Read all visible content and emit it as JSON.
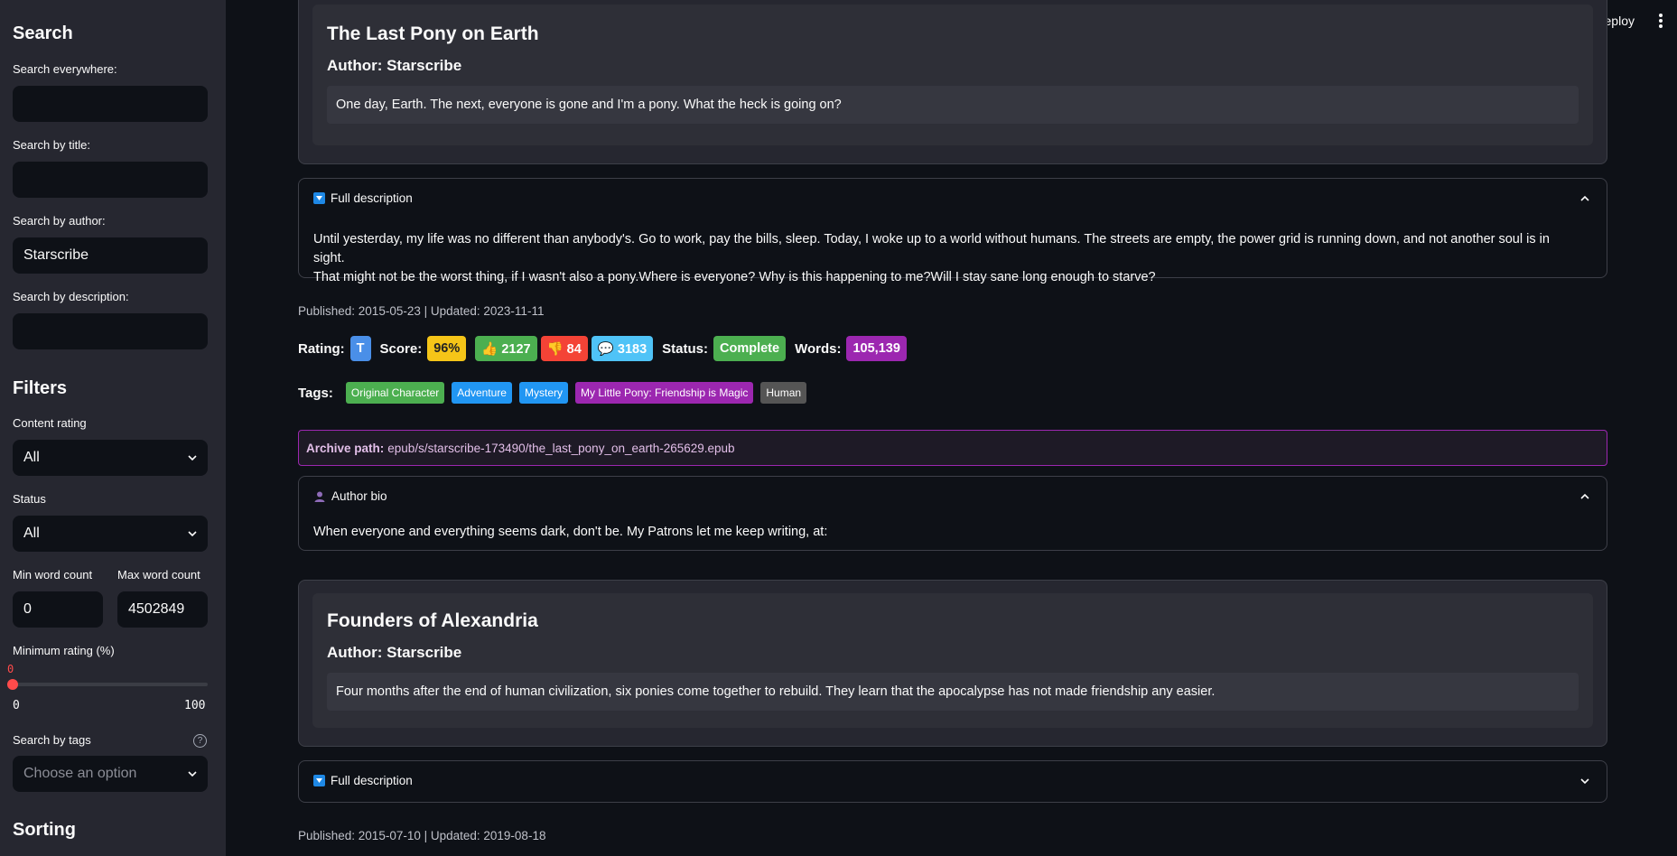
{
  "sidebar": {
    "search_title": "Search",
    "search_everywhere_label": "Search everywhere:",
    "search_everywhere_value": "",
    "search_title_label": "Search by title:",
    "search_title_value": "",
    "search_author_label": "Search by author:",
    "search_author_value": "Starscribe",
    "search_description_label": "Search by description:",
    "search_description_value": "",
    "filters_title": "Filters",
    "content_rating_label": "Content rating",
    "content_rating_value": "All",
    "status_label": "Status",
    "status_value": "All",
    "min_word_label": "Min word count",
    "min_word_value": "0",
    "max_word_label": "Max word count",
    "max_word_value": "4502849",
    "min_rating_label": "Minimum rating (%)",
    "min_rating_value": "0",
    "min_rating_min": "0",
    "min_rating_max": "100",
    "tags_label": "Search by tags",
    "tags_placeholder": "Choose an option",
    "help_glyph": "?",
    "sorting_title": "Sorting"
  },
  "header": {
    "deploy_label": "Deploy"
  },
  "stories": [
    {
      "title": "The Last Pony on Earth",
      "author": "Author: Starscribe",
      "short_description": "One day, Earth. The next, everyone is gone and I'm a pony. What the heck is going on?",
      "full_description_label": "Full description",
      "full_description_line1": "Until yesterday, my life was no different than anybody's. Go to work, pay the bills, sleep. Today, I woke up to a world without humans. The streets are empty, the power grid is running down, and not another soul is in sight.",
      "full_description_line2": "That might not be the worst thing, if I wasn't also a pony.Where is everyone? Why is this happening to me?Will I stay sane long enough to starve?",
      "published": "Published: 2015-05-23 | Updated: 2023-11-11",
      "rating_label": "Rating:",
      "rating_value": "T",
      "score_label": "Score:",
      "score_value": "96%",
      "likes": "👍 2127",
      "dislikes": "👎 84",
      "comments": "💬 3183",
      "status_label": "Status:",
      "status_value": "Complete",
      "words_label": "Words:",
      "words_value": "105,139",
      "tags_label": "Tags:",
      "tags": [
        "Original Character",
        "Adventure",
        "Mystery",
        "My Little Pony: Friendship is Magic",
        "Human"
      ],
      "archive_label": "Archive path:",
      "archive_path": "epub/s/starscribe-173490/the_last_pony_on_earth-265629.epub",
      "author_bio_label": "Author bio",
      "author_bio": "When everyone and everything seems dark, don't be. My Patrons let me keep writing, at:"
    },
    {
      "title": "Founders of Alexandria",
      "author": "Author: Starscribe",
      "short_description": "Four months after the end of human civilization, six ponies come together to rebuild. They learn that the apocalypse has not made friendship any easier.",
      "full_description_label": "Full description",
      "published": "Published: 2015-07-10 | Updated: 2019-08-18"
    }
  ],
  "colors": {
    "rating": "#4a8fe8",
    "score": "#f5c518",
    "likes": "#4caf50",
    "dislikes": "#f44336",
    "comments": "#4fc3f7",
    "status": "#4caf50",
    "words": "#9c27b0",
    "tag_green": "#4caf50",
    "tag_blue": "#2196f3",
    "tag_purple": "#9c27b0",
    "tag_gray": "#555555"
  }
}
